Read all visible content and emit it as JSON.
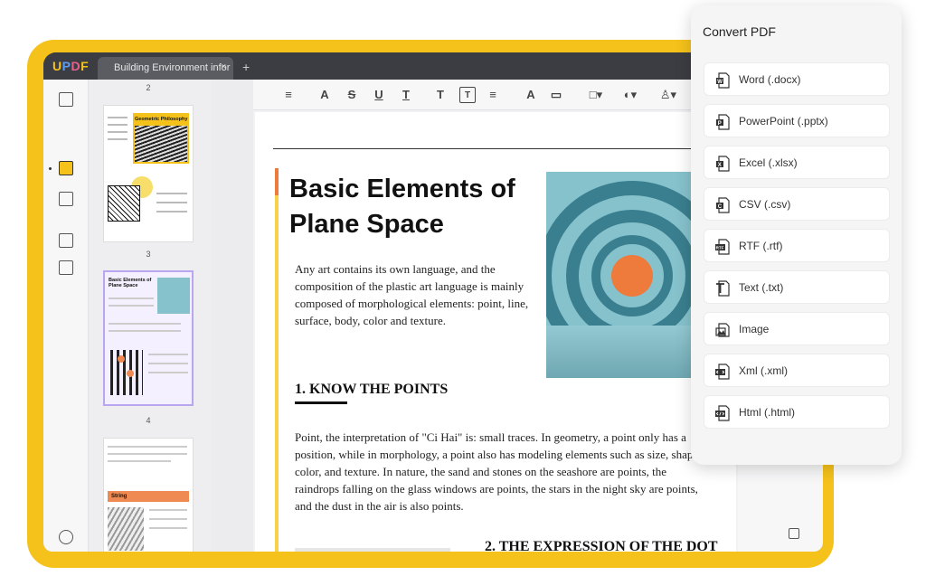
{
  "app": {
    "logo_letters": [
      "U",
      "P",
      "D",
      "F"
    ],
    "logo_colors": [
      "#f5c21b",
      "#5b9cf5",
      "#e8618c",
      "#f5c21b"
    ],
    "tab_title": "Building Environment infor",
    "tab_close": "×",
    "tab_add": "+"
  },
  "thumbnails": {
    "page_numbers": [
      "2",
      "3",
      "4"
    ],
    "thumb2_title": "Geometric Philosophy",
    "thumb3_title": "Basic Elements of Plane Space",
    "thumb4_heading": "String",
    "selected_page": "3"
  },
  "toolbar": {
    "tools": [
      "comment-icon",
      "highlight-icon",
      "strikethrough-icon",
      "underline-icon",
      "squiggly-icon",
      "text-icon",
      "textbox-icon",
      "callout-icon",
      "pencil-icon",
      "eraser-icon",
      "shape-icon",
      "sticker-icon",
      "stamp-icon"
    ],
    "glyphs": [
      "≡",
      "A",
      "S",
      "U",
      "T",
      "T",
      "T",
      "≡",
      "A",
      "▭",
      "□▾",
      "◐▾",
      "♙▾"
    ]
  },
  "document": {
    "title": "Basic Elements of Plane Space",
    "intro": "Any art contains its own language, and the composition of the plastic art language is mainly composed of morphological elements: point, line, surface, body, color and texture.",
    "section1_heading": "1. KNOW THE POINTS",
    "section1_body": "Point, the interpretation of \"Ci Hai\" is: small traces. In geometry, a point only has a position, while in morphology, a point also has modeling elements such as size, shape, color, and texture. In nature, the sand and stones on the seashore are points, the raindrops falling on the glass windows are points, the stars in the night sky are points, and the dust in the air is also points.",
    "section2_heading": "2. THE EXPRESSION OF THE DOT"
  },
  "convert_panel": {
    "title": "Convert PDF",
    "options": [
      {
        "label": "Word (.docx)",
        "icon": "word-icon"
      },
      {
        "label": "PowerPoint (.pptx)",
        "icon": "powerpoint-icon"
      },
      {
        "label": "Excel (.xlsx)",
        "icon": "excel-icon"
      },
      {
        "label": "CSV (.csv)",
        "icon": "csv-icon"
      },
      {
        "label": "RTF (.rtf)",
        "icon": "rtf-icon"
      },
      {
        "label": "Text (.txt)",
        "icon": "text-file-icon"
      },
      {
        "label": "Image",
        "icon": "image-icon"
      },
      {
        "label": "Xml (.xml)",
        "icon": "xml-icon"
      },
      {
        "label": "Html (.html)",
        "icon": "html-icon"
      }
    ]
  },
  "colors": {
    "frame": "#f5c21b",
    "accent_orange": "#ee7a3c",
    "selection": "#b9a5f0"
  }
}
